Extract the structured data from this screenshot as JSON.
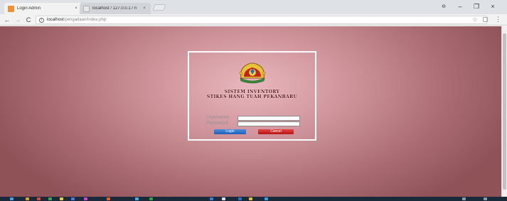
{
  "tabs": [
    {
      "title": "Login Admin",
      "close": "×"
    },
    {
      "title": "localhost / 127.0.0.1 / n",
      "close": "×"
    }
  ],
  "window_controls": {
    "minimize": "–",
    "maximize": "❐",
    "close": "×"
  },
  "nav": {
    "back": "←",
    "forward": "→",
    "reload": "C"
  },
  "address": {
    "host": "localhost",
    "path": "/pengadaan/index.php",
    "info_glyph": "i"
  },
  "toolbar_icons": {
    "star": "☆",
    "menu": "⋮"
  },
  "login": {
    "title_line1": "SISTEM INVENTORY",
    "title_line2": "STIKES HANG TUAH PEKANBARU",
    "username_label": "Username",
    "password_label": "Password",
    "username_value": "",
    "password_value": "",
    "login_button": "Login",
    "cancel_button": "Cancel"
  },
  "colors": {
    "login_button": "#1d5eb8",
    "cancel_button": "#b51212",
    "title_text": "#5a0d13",
    "background_center": "#e8b7bd",
    "background_edge": "#8e5257"
  }
}
